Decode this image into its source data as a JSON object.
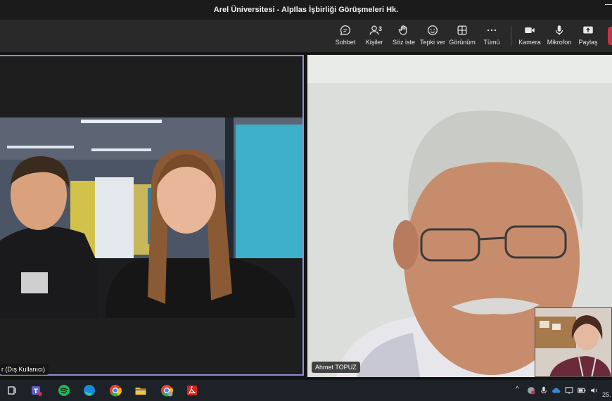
{
  "window": {
    "title": "Arel Üniversitesi - AlpIlas İşbirliği Görüşmeleri Hk."
  },
  "toolbar": {
    "chat": "Sohbet",
    "people": "Kişiler",
    "people_count": "3",
    "raise_hand": "Söz iste",
    "react": "Tepki ver",
    "view": "Görünüm",
    "more": "Tümü",
    "camera": "Kamera",
    "mic": "Mikrofon",
    "share": "Paylaş"
  },
  "participants": {
    "left": {
      "name": "r (Dış Kullanıcı)"
    },
    "right": {
      "name": "Ahmet TOPUZ"
    }
  },
  "taskbar": {
    "clock": "25."
  },
  "colors": {
    "active_border": "#8c90d4",
    "leave": "#c4314b",
    "teams": "#5b5fc7"
  }
}
